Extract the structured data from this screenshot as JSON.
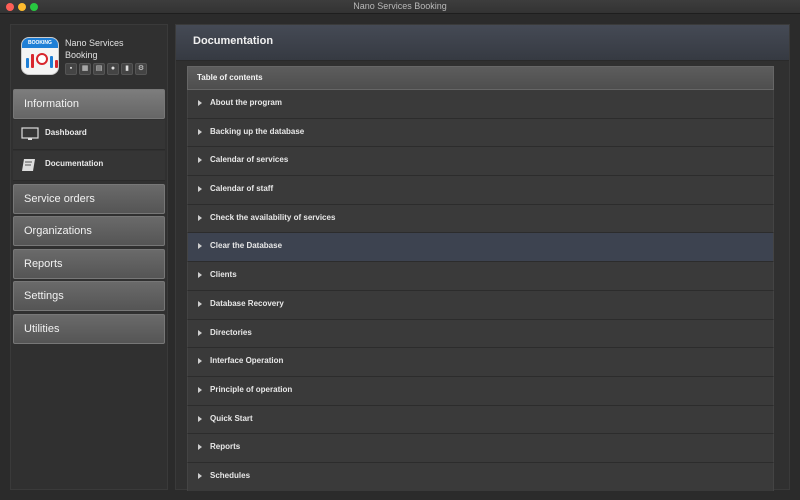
{
  "window": {
    "title": "Nano Services Booking"
  },
  "app": {
    "name": "Nano Services Booking",
    "icon_header": "BOOKING"
  },
  "sidebar": {
    "sections": [
      {
        "label": "Information",
        "active": true
      },
      {
        "label": "Service orders"
      },
      {
        "label": "Organizations"
      },
      {
        "label": "Reports"
      },
      {
        "label": "Settings"
      },
      {
        "label": "Utilities"
      }
    ],
    "sub_items": [
      {
        "label": "Dashboard",
        "icon": "monitor-icon"
      },
      {
        "label": "Documentation",
        "icon": "book-icon"
      }
    ],
    "mini_icons": [
      "briefcase-icon",
      "calendar-icon",
      "calendar-grid-icon",
      "person-icon",
      "book-icon",
      "gears-icon"
    ]
  },
  "main": {
    "title": "Documentation",
    "toc_header": "Table of contents",
    "selected_index": 5,
    "items": [
      "About the program",
      "Backing up the database",
      "Calendar of services",
      "Calendar of staff",
      "Check the availability of services",
      "Clear the Database",
      "Clients",
      "Database Recovery",
      "Directories",
      "Interface Operation",
      "Principle of operation",
      "Quick Start",
      "Reports",
      "Schedules"
    ]
  },
  "colors": {
    "close": "#fe5f57",
    "minimize": "#febc2e",
    "maximize": "#28c840",
    "selected_row": "#3d4350"
  }
}
